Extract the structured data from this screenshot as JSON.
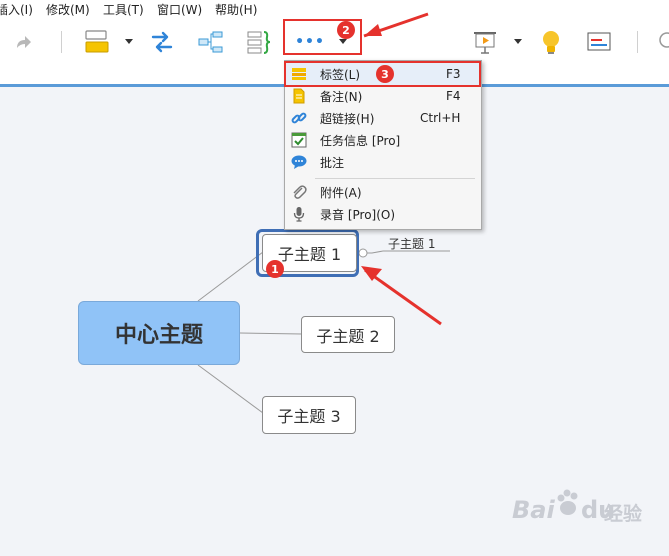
{
  "menubar": {
    "items": [
      "插入(I)",
      "修改(M)",
      "工具(T)",
      "窗口(W)",
      "帮助(H)"
    ]
  },
  "toolbar": {
    "more_label": "•••"
  },
  "dropdown": {
    "items": [
      {
        "label": "标签(L)",
        "shortcut": "F3",
        "icon": "label-icon"
      },
      {
        "label": "备注(N)",
        "shortcut": "F4",
        "icon": "note-icon"
      },
      {
        "label": "超链接(H)",
        "shortcut": "Ctrl+H",
        "icon": "hyperlink-icon"
      },
      {
        "label": "任务信息 [Pro]",
        "shortcut": "",
        "icon": "task-info-icon"
      },
      {
        "label": "批注",
        "shortcut": "",
        "icon": "comment-icon"
      },
      {
        "label": "附件(A)",
        "shortcut": "",
        "icon": "attachment-icon"
      },
      {
        "label": "录音 [Pro](O)",
        "shortcut": "",
        "icon": "microphone-icon"
      }
    ]
  },
  "mindmap": {
    "central": "中心主题",
    "topics": [
      "子主题 1",
      "子主题 2",
      "子主题 3"
    ],
    "subtopic": "子主题 1"
  },
  "annotations": {
    "badges": [
      "1",
      "2",
      "3"
    ],
    "accent": "#e5322d"
  },
  "watermark": {
    "brand": "Bai",
    "brand2": "du",
    "site": "经验"
  }
}
